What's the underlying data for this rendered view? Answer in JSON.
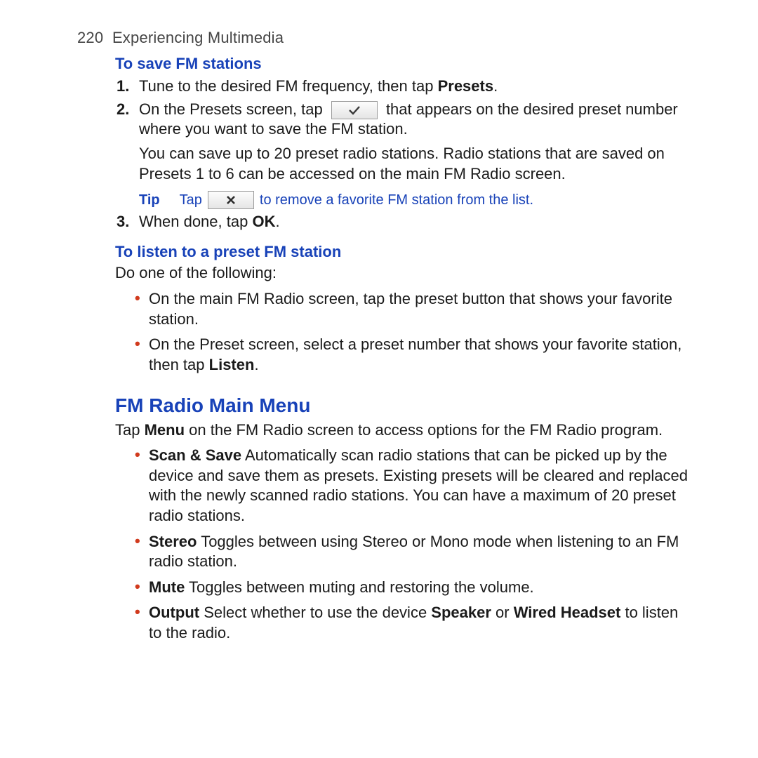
{
  "header": {
    "page_number": "220",
    "chapter": "Experiencing Multimedia"
  },
  "save_section": {
    "heading": "To save FM stations",
    "step1_pre": "Tune to the desired FM frequency, then tap ",
    "step1_bold": "Presets",
    "step1_post": ".",
    "step2_pre": "On the Presets screen, tap ",
    "step2_post": " that appears on the desired preset number where you want to save the FM station.",
    "step2_extra": "You can save up to 20 preset radio stations. Radio stations that are saved on Presets 1 to 6 can be accessed on the main FM Radio screen.",
    "tip_label": "Tip",
    "tip_pre": "Tap ",
    "tip_post": " to remove a favorite FM station from the list.",
    "step3_pre": "When done, tap ",
    "step3_bold": "OK",
    "step3_post": "."
  },
  "listen_section": {
    "heading": "To listen to a preset FM station",
    "intro": "Do one of the following:",
    "bullet1": "On the main FM Radio screen, tap the preset button that shows your favorite station.",
    "bullet2_pre": "On the Preset screen, select a preset number that shows your favorite station, then tap ",
    "bullet2_bold": "Listen",
    "bullet2_post": "."
  },
  "menu_section": {
    "heading": "FM Radio Main Menu",
    "intro_pre": "Tap ",
    "intro_bold": "Menu",
    "intro_post": " on the FM Radio screen to access options for the FM Radio program.",
    "b1_bold": "Scan & Save",
    "b1_text": " Automatically scan radio stations that can be picked up by the device and save them as presets. Existing presets will be cleared and replaced with the newly scanned radio stations. You can have a maximum of 20 preset radio stations.",
    "b2_bold": "Stereo",
    "b2_text": " Toggles between using Stereo or Mono mode when listening to an FM radio station.",
    "b3_bold": "Mute",
    "b3_text": " Toggles between muting and restoring the volume.",
    "b4_bold": "Output",
    "b4_mid1": " Select whether to use the device ",
    "b4_bold2": "Speaker",
    "b4_mid2": " or ",
    "b4_bold3": "Wired Headset",
    "b4_post": " to listen to the radio."
  }
}
